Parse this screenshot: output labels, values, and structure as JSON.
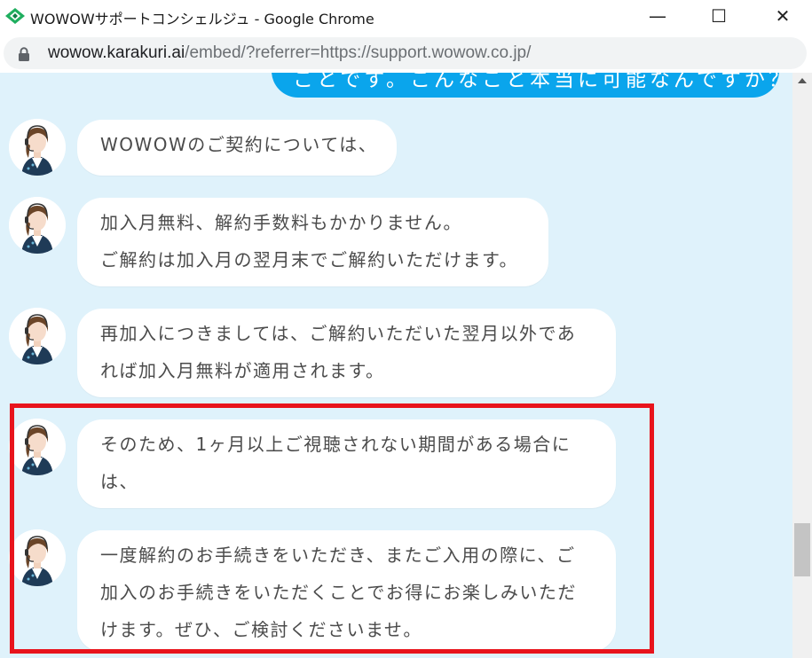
{
  "window": {
    "title": "WOWOWサポートコンシェルジュ - Google Chrome",
    "minimize": "—",
    "maximize": "☐",
    "close": "✕"
  },
  "address": {
    "host": "wowow.karakuri.ai",
    "path": "/embed/?referrer=https://support.wowow.co.jp/"
  },
  "chat": {
    "user_message": "ことです。こんなこと本当に可能なんですか？",
    "messages": [
      {
        "lines": [
          "WOWOWのご契約については、"
        ]
      },
      {
        "lines": [
          "加入月無料、解約手数料もかかりません。",
          "ご解約は加入月の翌月末でご解約いただけます。"
        ]
      },
      {
        "lines": [
          "再加入につきましては、ご解約いただいた翌月以外であ",
          "れば加入月無料が適用されます。"
        ]
      },
      {
        "lines": [
          "そのため、1ヶ月以上ご視聴されない期間がある場合に",
          "は、"
        ]
      },
      {
        "lines": [
          "一度解約のお手続きをいただき、またご入用の際に、ご",
          "加入のお手続きをいただくことでお得にお楽しみいただ",
          "けます。ぜひ、ご検討くださいませ。"
        ]
      }
    ]
  },
  "colors": {
    "chat_background": "#dff2fb",
    "user_bubble": "#0aa5ec",
    "highlight_border": "#e8141c",
    "brand_logo": "#1fae5f"
  },
  "icons": {
    "app": "wowow-diamond-logo",
    "lock": "lock-icon",
    "avatar": "operator-headset-avatar"
  }
}
